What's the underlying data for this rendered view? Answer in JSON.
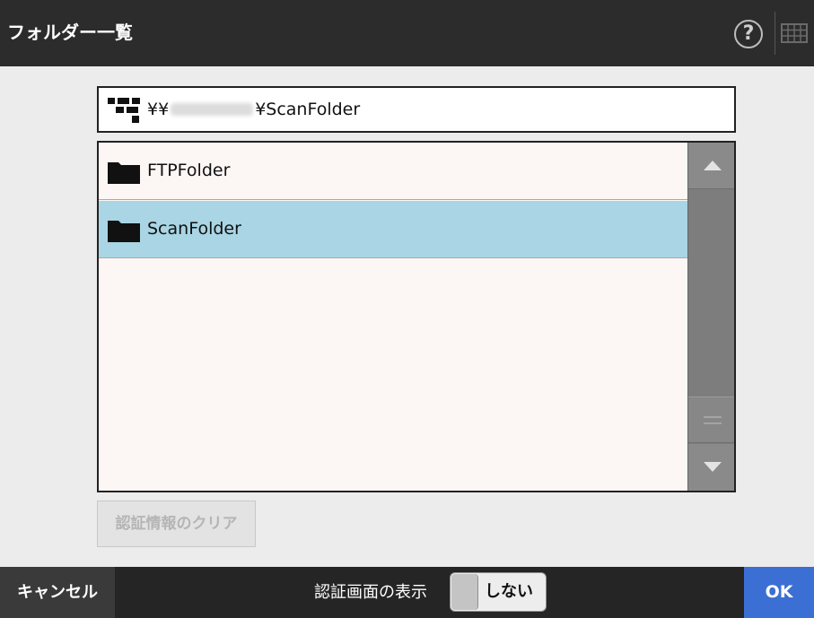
{
  "header": {
    "title": "フォルダー一覧",
    "help_label": "?",
    "help_icon": "help-circle-icon",
    "keyboard_icon": "keyboard-icon"
  },
  "path": {
    "icon": "network-icon",
    "prefix": "¥¥",
    "suffix": "¥ScanFolder"
  },
  "folders": [
    {
      "label": "FTPFolder",
      "icon": "folder-icon",
      "selected": false
    },
    {
      "label": "ScanFolder",
      "icon": "folder-icon",
      "selected": true
    }
  ],
  "buttons": {
    "clear_auth": "認証情報のクリア",
    "cancel": "キャンセル",
    "ok": "OK"
  },
  "auth_display": {
    "label": "認証画面の表示",
    "toggle_value": "しない"
  },
  "colors": {
    "header_bg": "#2c2c2c",
    "selected_row": "#a9d5e4",
    "ok_button": "#3b6fd4",
    "list_bg": "#fcf6f4"
  }
}
